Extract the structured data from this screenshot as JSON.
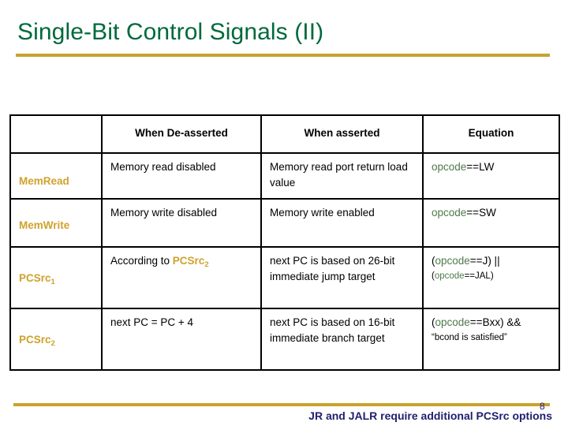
{
  "slide": {
    "title": "Single-Bit Control Signals (II)",
    "page_number": "8",
    "footer_note": "JR and JALR require additional PCSrc options"
  },
  "colors": {
    "title_green": "#00693C",
    "rule_gold": "#C8A22C",
    "signal_gold": "#CFA22C",
    "opcode_green": "#4F7A4A",
    "footer_blue": "#1F1F6E",
    "border_black": "#000000"
  },
  "table": {
    "headers": [
      "",
      "When De-asserted",
      "When asserted",
      "Equation"
    ],
    "rows": [
      {
        "signal": "Mem",
        "signal_sub": "",
        "signal_tail": "Read",
        "deasserted": "Memory read disabled",
        "deasserted_prefix": "Memory read disabled",
        "deasserted_gold": "",
        "deasserted_gold_sub": "",
        "asserted": "Memory read port return load value",
        "equation_line1_prefix": "opcode",
        "equation_line1_rest": "==LW",
        "equation_line2": ""
      },
      {
        "signal": "Mem",
        "signal_sub": "",
        "signal_tail": "Write",
        "deasserted": "Memory write disabled",
        "deasserted_prefix": "Memory write disabled",
        "deasserted_gold": "",
        "deasserted_gold_sub": "",
        "asserted": "Memory write enabled",
        "equation_line1_prefix": "opcode",
        "equation_line1_rest": "==SW",
        "equation_line2": ""
      },
      {
        "signal": "PCSrc",
        "signal_sub": "1",
        "signal_tail": "",
        "deasserted": "According to PCSrc2",
        "deasserted_prefix": "According to ",
        "deasserted_gold": "PCSrc",
        "deasserted_gold_sub": "2",
        "asserted": "next PC is based on 26-bit immediate jump target",
        "equation_line1_prefix": "opcode",
        "equation_line1_rest": "==J) ||",
        "equation_line1_open": "(",
        "equation_line2_open": "(",
        "equation_line2_prefix": "opcode",
        "equation_line2_rest": "==JAL)"
      },
      {
        "signal": "PCSrc",
        "signal_sub": "2",
        "signal_tail": "",
        "deasserted": "next PC = PC + 4",
        "deasserted_prefix": "next PC = PC + 4",
        "deasserted_gold": "",
        "deasserted_gold_sub": "",
        "asserted": "next PC is based on 16-bit immediate branch target",
        "equation_line1_prefix": "opcode",
        "equation_line1_rest": "==Bxx) &&",
        "equation_line1_open": "(",
        "equation_line2_open": "",
        "equation_line2_prefix": "",
        "equation_line2_rest": "“bcond is satisfied”"
      }
    ]
  }
}
